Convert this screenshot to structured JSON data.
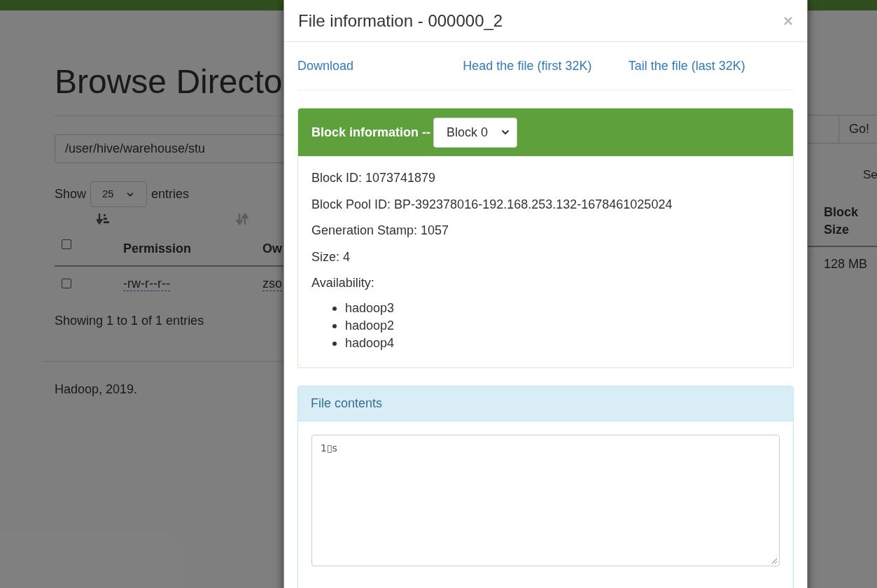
{
  "page": {
    "title": "Browse Directo",
    "path_field": {
      "value": "/user/hive/warehouse/stu"
    },
    "go_button": "Go!",
    "show_label": "Show",
    "page_size": "25",
    "entries_label": "entries",
    "search_label": "Se",
    "table": {
      "select_all": {
        "checked": false
      },
      "columns": [
        {
          "label": "Permission",
          "kind": "sorted"
        },
        {
          "label": "Ow",
          "kind": "sortable"
        },
        {
          "label": "Block Size"
        }
      ],
      "rows": [
        {
          "checked": false,
          "cells": [
            "-rw-r--r--",
            "zso",
            "128 MB"
          ]
        }
      ]
    },
    "info": "Showing 1 to 1 of 1 entries",
    "footer": "Hadoop, 2019."
  },
  "modal": {
    "title": "File information - 000000_2",
    "close": "×",
    "links": [
      "Download",
      "Head the file (first 32K)",
      "Tail the file (last 32K)"
    ],
    "block_panel": {
      "title": "Block information --",
      "block_select": "Block 0",
      "lines": [
        "Block ID: 1073741879",
        "Block Pool ID: BP-392378016-192.168.253.132-1678461025024",
        "Generation Stamp: 1057",
        "Size: 4"
      ],
      "availability_label": "Availability:",
      "hosts": [
        "hadoop3",
        "hadoop2",
        "hadoop4"
      ]
    },
    "contents_panel": {
      "title": "File contents",
      "text": "1▯s"
    }
  }
}
